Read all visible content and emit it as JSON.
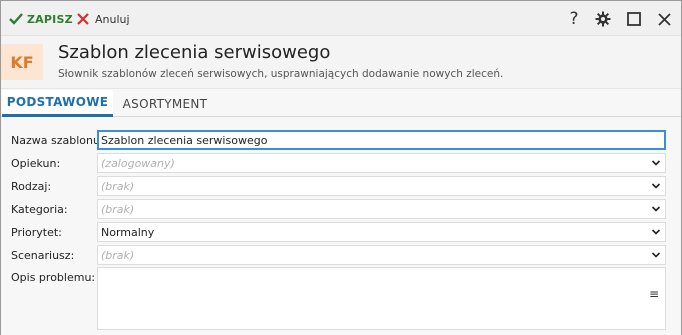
{
  "toolbar": {
    "save_label": "ZAPISZ",
    "cancel_label": "Anuluj",
    "help_label": "?"
  },
  "header": {
    "badge": "KF",
    "title": "Szablon zlecenia serwisowego",
    "subtitle": "Słownik szablonów zleceń serwisowych, usprawniających dodawanie nowych zleceń."
  },
  "tabs": [
    {
      "label": "PODSTAWOWE",
      "active": true
    },
    {
      "label": "ASORTYMENT",
      "active": false
    }
  ],
  "form": {
    "name": {
      "label": "Nazwa szablonu:",
      "value": "Szablon zlecenia serwisowego"
    },
    "guardian": {
      "label": "Opiekun:",
      "placeholder": "(zalogowany)"
    },
    "kind": {
      "label": "Rodzaj:",
      "placeholder": "(brak)"
    },
    "category": {
      "label": "Kategoria:",
      "placeholder": "(brak)"
    },
    "priority": {
      "label": "Priorytet:",
      "value": "Normalny"
    },
    "scenario": {
      "label": "Scenariusz:",
      "placeholder": "(brak)"
    },
    "description": {
      "label": "Opis problemu:",
      "menu_icon": "≡"
    }
  },
  "colors": {
    "accent": "#1f6fae",
    "save_green": "#2e7d32",
    "cancel_red": "#d32f2f",
    "badge_bg": "#fce5d3",
    "badge_fg": "#e07a2a"
  }
}
